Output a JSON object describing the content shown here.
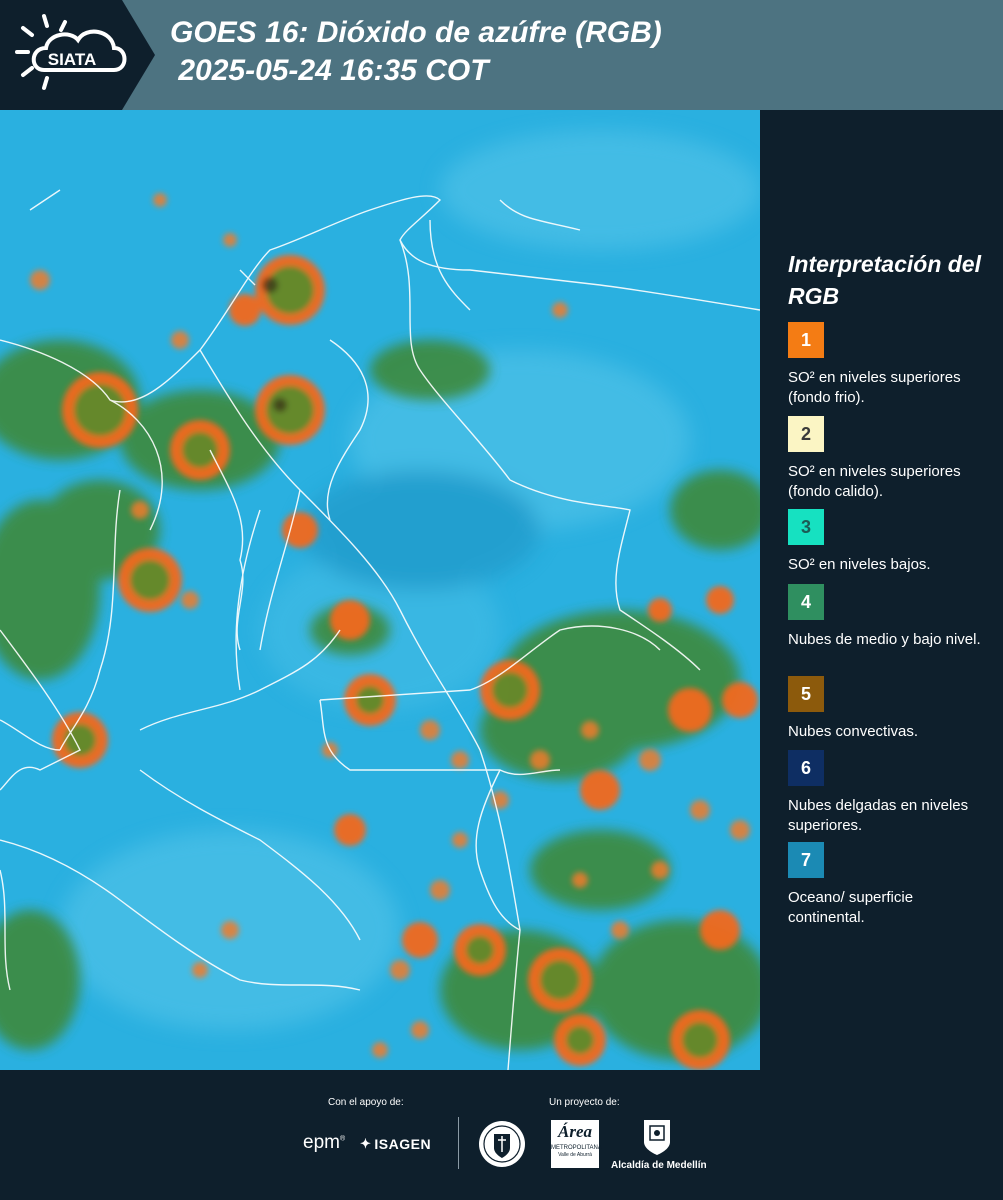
{
  "header": {
    "logo_text": "SIATA",
    "title_line1": "GOES 16: Dióxido de azúfre (RGB)",
    "title_line2": " 2025-05-24 16:35 COT"
  },
  "legend": {
    "title": "Interpretación del RGB",
    "items": [
      {
        "number": "1",
        "color": "#f47c14",
        "text_color": "#ffffff",
        "text": "SO² en niveles superiores (fondo frio)."
      },
      {
        "number": "2",
        "color": "#fbf5c4",
        "text_color": "#3a3a3a",
        "text": "SO² en niveles superiores (fondo calido)."
      },
      {
        "number": "3",
        "color": "#16e1c1",
        "text_color": "#1b5c55",
        "text": "SO² en niveles bajos."
      },
      {
        "number": "4",
        "color": "#2f8f60",
        "text_color": "#ffffff",
        "text": "Nubes de medio y bajo nivel."
      },
      {
        "number": "5",
        "color": "#8c5a0c",
        "text_color": "#ffffff",
        "text": "Nubes convectivas."
      },
      {
        "number": "6",
        "color": "#0e2e63",
        "text_color": "#ffffff",
        "text": "Nubes delgadas en niveles superiores."
      },
      {
        "number": "7",
        "color": "#1b8ab4",
        "text_color": "#ffffff",
        "text": "Oceano/ superficie continental."
      }
    ]
  },
  "footer": {
    "support_caption": "Con el apoyo de:",
    "project_caption": "Un proyecto de:",
    "sponsor_epm": "epm",
    "sponsor_isagen": "ISAGEN",
    "area_text": "Área",
    "area_subtitle": "METROPOLITANA",
    "area_subtitle2": "Valle de Aburrá",
    "alcaldia": "Alcaldía de Medellín"
  }
}
